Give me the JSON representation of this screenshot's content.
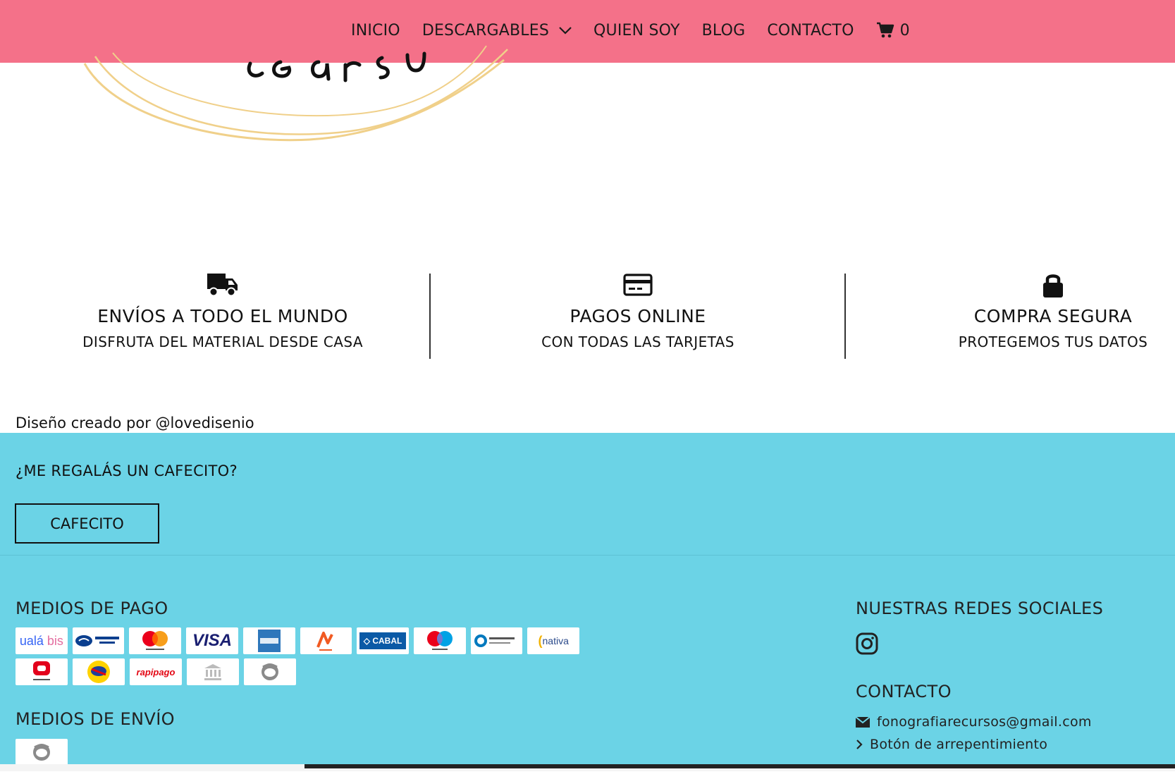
{
  "nav": {
    "items": [
      "INICIO",
      "DESCARGABLES",
      "QUIEN SOY",
      "BLOG",
      "CONTACTO"
    ],
    "cart_count": "0"
  },
  "benefits": [
    {
      "icon": "truck-icon",
      "title": "ENVÍOS A TODO EL MUNDO",
      "subtitle": "DISFRUTA DEL MATERIAL DESDE CASA"
    },
    {
      "icon": "credit-card-icon",
      "title": "PAGOS ONLINE",
      "subtitle": "CON TODAS LAS TARJETAS"
    },
    {
      "icon": "lock-icon",
      "title": "COMPRA SEGURA",
      "subtitle": "PROTEGEMOS TUS DATOS"
    }
  ],
  "credit": "Diseño creado por @lovedisenio",
  "cafecito": {
    "question": "¿ME REGALÁS UN CAFECITO?",
    "button": "CAFECITO"
  },
  "payment": {
    "heading": "MEDIOS DE PAGO",
    "methods": [
      "ualá bis",
      "mercado pago",
      "mastercard",
      "VISA",
      "american express",
      "naranja",
      "CABAL",
      "maestro",
      "Diners Club",
      "nativa",
      "Argencard",
      "pago fácil",
      "rapipago",
      "bank transfer",
      "cash"
    ]
  },
  "shipping": {
    "heading": "MEDIOS DE ENVÍO"
  },
  "social": {
    "heading": "NUESTRAS REDES SOCIALES"
  },
  "contact": {
    "heading": "CONTACTO",
    "email": "fonografiarecursos@gmail.com",
    "regret": "Botón de arrepentimiento"
  },
  "colors": {
    "nav_bg": "#f47189",
    "footer_bg": "#6bd3e6",
    "logo_ring": "#f0d08a"
  }
}
